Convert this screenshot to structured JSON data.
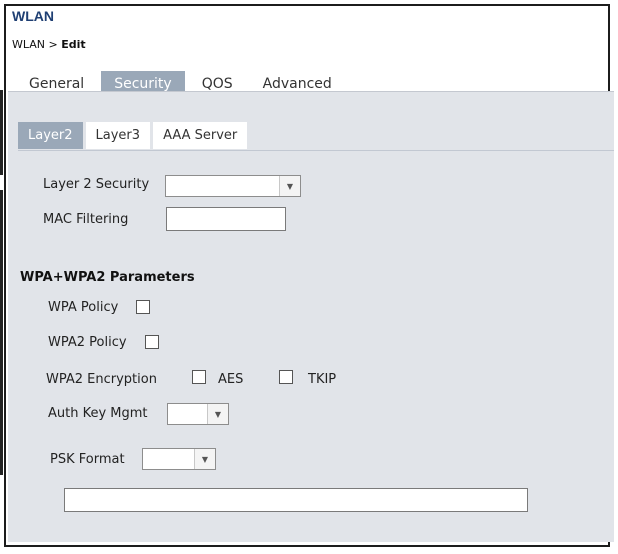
{
  "window": {
    "title": "WLAN"
  },
  "breadcrumb": {
    "parent": "WLAN",
    "separator": ">",
    "current": "Edit"
  },
  "top_tabs": [
    {
      "label": "General",
      "active": false
    },
    {
      "label": "Security",
      "active": true
    },
    {
      "label": "QOS",
      "active": false
    },
    {
      "label": "Advanced",
      "active": false
    }
  ],
  "sub_tabs": [
    {
      "label": "Layer2",
      "active": true
    },
    {
      "label": "Layer3",
      "active": false
    },
    {
      "label": "AAA Server",
      "active": false
    }
  ],
  "form": {
    "layer2_security": {
      "label": "Layer 2 Security",
      "value": ""
    },
    "mac_filtering": {
      "label": "MAC Filtering",
      "value": ""
    },
    "wpa_section_title": "WPA+WPA2 Parameters",
    "wpa_policy": {
      "label": "WPA Policy",
      "checked": false
    },
    "wpa2_policy": {
      "label": "WPA2 Policy",
      "checked": false
    },
    "wpa2_encryption": {
      "label": "WPA2 Encryption",
      "aes": {
        "label": "AES",
        "checked": false
      },
      "tkip": {
        "label": "TKIP",
        "checked": false
      }
    },
    "auth_key_mgmt": {
      "label": "Auth Key Mgmt",
      "value": ""
    },
    "psk_format": {
      "label": "PSK Format",
      "value": ""
    },
    "psk_value": ""
  },
  "colors": {
    "title": "#1f3f73",
    "active_tab": "#9aa8b8",
    "panel_bg": "#e1e4e9"
  }
}
